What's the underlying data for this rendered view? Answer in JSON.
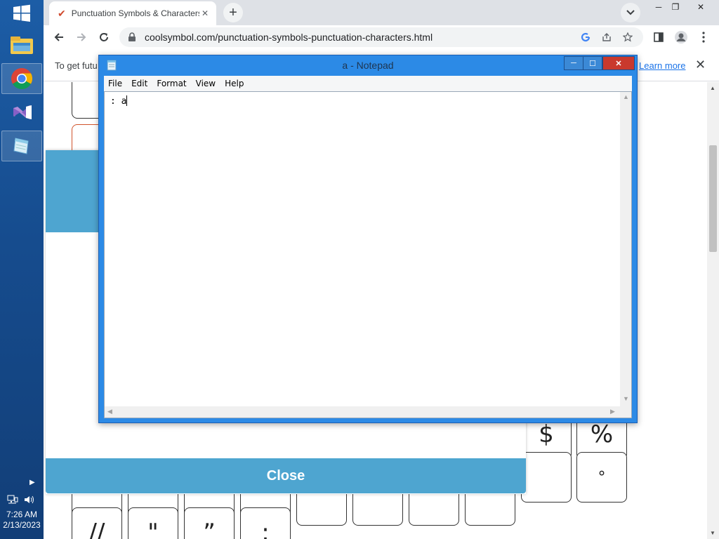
{
  "taskbar": {
    "apps": [
      {
        "name": "File Explorer",
        "icon": "file-explorer-icon"
      },
      {
        "name": "Google Chrome",
        "icon": "chrome-icon"
      },
      {
        "name": "Visual Studio",
        "icon": "visual-studio-icon"
      },
      {
        "name": "Notepad",
        "icon": "notepad-icon"
      }
    ],
    "time": "7:26 AM",
    "date": "2/13/2023"
  },
  "browser": {
    "tab_title": "Punctuation Symbols & Characters",
    "url": "coolsymbol.com/punctuation-symbols-punctuation-characters.html",
    "infobar_text": "To get futu",
    "learn_more": "Learn more"
  },
  "page": {
    "keys_visible": [
      "$",
      "%",
      "°",
      "//",
      "\"",
      "”",
      ":"
    ],
    "modal_close_label": "Close"
  },
  "notepad": {
    "title": "a - Notepad",
    "menu": [
      "File",
      "Edit",
      "Format",
      "View",
      "Help"
    ],
    "content": ": a"
  }
}
